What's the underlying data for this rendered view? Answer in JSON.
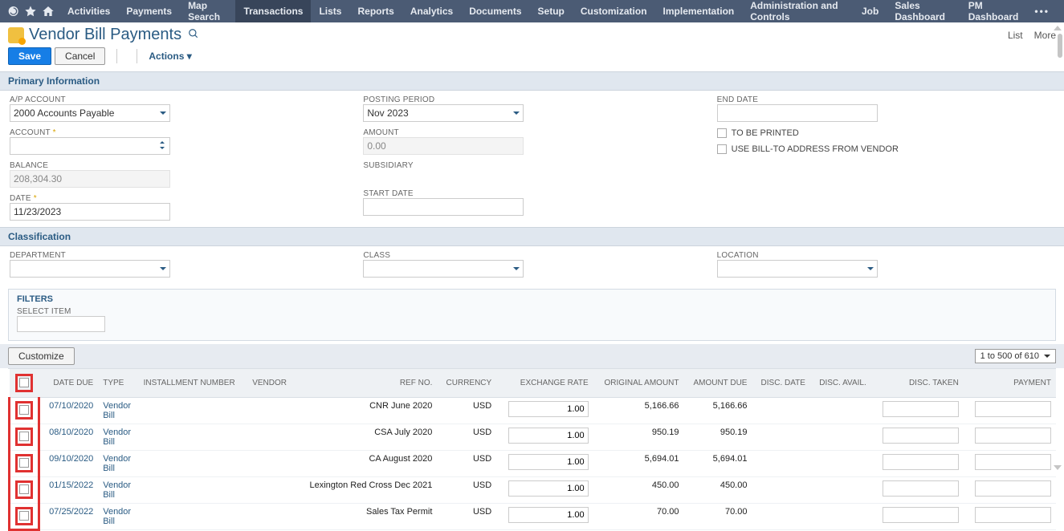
{
  "nav": {
    "items": [
      "Activities",
      "Payments",
      "Map Search",
      "Transactions",
      "Lists",
      "Reports",
      "Analytics",
      "Documents",
      "Setup",
      "Customization",
      "Implementation",
      "Administration and Controls",
      "Job",
      "Sales Dashboard",
      "PM Dashboard"
    ],
    "active": "Transactions"
  },
  "page": {
    "title": "Vendor Bill Payments",
    "rightLinks": [
      "List",
      "More"
    ]
  },
  "actions": {
    "save": "Save",
    "cancel": "Cancel",
    "actions": "Actions ▾"
  },
  "sections": {
    "primary": "Primary Information",
    "classification": "Classification"
  },
  "primary": {
    "ap_label": "A/P ACCOUNT",
    "ap_value": "2000 Accounts Payable",
    "account_label": "ACCOUNT",
    "account_value": "",
    "balance_label": "BALANCE",
    "balance_value": "208,304.30",
    "date_label": "DATE",
    "date_value": "11/23/2023",
    "posting_label": "POSTING PERIOD",
    "posting_value": "Nov 2023",
    "amount_label": "AMOUNT",
    "amount_value": "0.00",
    "subsidiary_label": "SUBSIDIARY",
    "subsidiary_value": "",
    "startdate_label": "START DATE",
    "enddate_label": "END DATE",
    "tobeprinted": "TO BE PRINTED",
    "usebillto": "USE BILL-TO ADDRESS FROM VENDOR"
  },
  "classification": {
    "dept_label": "DEPARTMENT",
    "class_label": "CLASS",
    "location_label": "LOCATION"
  },
  "filters": {
    "title": "FILTERS",
    "selectitem": "SELECT ITEM"
  },
  "customize": "Customize",
  "pager": "1 to 500 of 610",
  "table": {
    "headers": {
      "datedue": "DATE DUE",
      "type": "TYPE",
      "installment": "INSTALLMENT NUMBER",
      "vendor": "VENDOR",
      "refno": "REF NO.",
      "currency": "CURRENCY",
      "exrate": "EXCHANGE RATE",
      "origamt": "ORIGINAL AMOUNT",
      "amtdue": "AMOUNT DUE",
      "discdate": "DISC. DATE",
      "discavail": "DISC. AVAIL.",
      "disctaken": "DISC. TAKEN",
      "payment": "PAYMENT"
    },
    "rows": [
      {
        "date": "07/10/2020",
        "type": "Vendor Bill",
        "ref": "CNR June 2020",
        "cur": "USD",
        "rate": "1.00",
        "orig": "5,166.66",
        "due": "5,166.66"
      },
      {
        "date": "08/10/2020",
        "type": "Vendor Bill",
        "ref": "CSA July 2020",
        "cur": "USD",
        "rate": "1.00",
        "orig": "950.19",
        "due": "950.19"
      },
      {
        "date": "09/10/2020",
        "type": "Vendor Bill",
        "ref": "CA August 2020",
        "cur": "USD",
        "rate": "1.00",
        "orig": "5,694.01",
        "due": "5,694.01"
      },
      {
        "date": "01/15/2022",
        "type": "Vendor Bill",
        "ref": "Lexington Red Cross Dec 2021",
        "cur": "USD",
        "rate": "1.00",
        "orig": "450.00",
        "due": "450.00"
      },
      {
        "date": "07/25/2022",
        "type": "Vendor Bill",
        "ref": "Sales Tax Permit",
        "cur": "USD",
        "rate": "1.00",
        "orig": "70.00",
        "due": "70.00"
      }
    ]
  }
}
